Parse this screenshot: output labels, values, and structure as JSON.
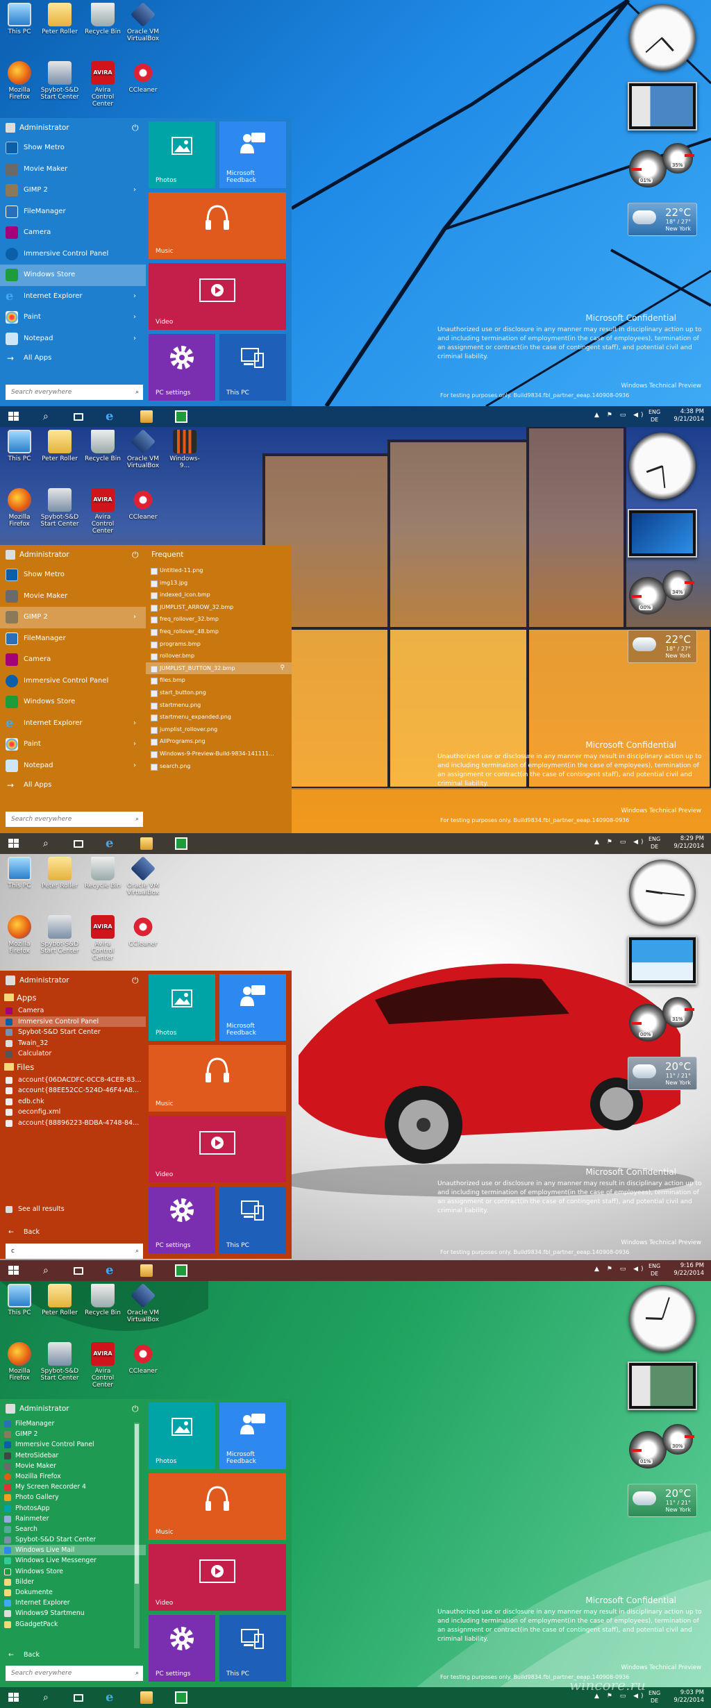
{
  "desktop_icons_row1": [
    "This PC",
    "Peter Roller",
    "Recycle Bin",
    "Oracle VM VirtualBox"
  ],
  "desktop_icons_row2": [
    "Mozilla Firefox",
    "Spybot-S&D Start Center",
    "Avira Control Center",
    "CCleaner"
  ],
  "extra_icon": "Windows-9...",
  "avira_text": "AVIRA",
  "user": "Administrator",
  "power_glyph": "⏻",
  "arrow_glyph": "›",
  "all_apps": "All Apps",
  "back": "Back",
  "search_placeholder": "Search everywhere",
  "search_query": "c",
  "frequent_title": "Frequent",
  "menu_items": [
    "Show Metro",
    "Movie Maker",
    "GIMP 2",
    "FileManager",
    "Camera",
    "Immersive Control Panel",
    "Windows Store",
    "Internet Explorer",
    "Paint",
    "Notepad"
  ],
  "frequent_items": [
    "Untitled-11.png",
    "img13.jpg",
    "indexed_icon.bmp",
    "JUMPLIST_ARROW_32.bmp",
    "freq_rollover_32.bmp",
    "freq_rollover_48.bmp",
    "programs.bmp",
    "rollover.bmp",
    "JUMPLIST_BUTTON_32.bmp",
    "files.bmp",
    "start_button.png",
    "startmenu.png",
    "startmenu_expanded.png",
    "jumplist_rollover.png",
    "AllPrograms.png",
    "Windows-9-Preview-Build-9834-141111...",
    "search.png"
  ],
  "search_results": {
    "apps_header": "Apps",
    "apps": [
      "Camera",
      "Immersive Control Panel",
      "Spybot-S&D Start Center",
      "Twain_32",
      "Calculator"
    ],
    "files_header": "Files",
    "files": [
      "account{06DACDFC-0CC8-4CEB-83...",
      "account{88EE52CC-524D-46F4-A8...",
      "edb.chk",
      "oeconfig.xml",
      "account{88896223-BDBA-4748-84..."
    ],
    "see_all": "See all results"
  },
  "all_apps_list": [
    "FileManager",
    "GIMP 2",
    "Immersive Control Panel",
    "MetroSidebar",
    "Movie Maker",
    "Mozilla Firefox",
    "My Screen Recorder 4",
    "Photo Gallery",
    "PhotosApp",
    "Rainmeter",
    "Search",
    "Spybot-S&D Start Center",
    "Windows Live Mail",
    "Windows Live Messenger",
    "Windows Store",
    "Bilder",
    "Dokumente",
    "Internet Explorer",
    "Windows9 Startmenu",
    "8GadgetPack"
  ],
  "tiles": {
    "photos": "Photos",
    "feedback": "Microsoft Feedback",
    "music": "Music",
    "video": "Video",
    "settings": "PC settings",
    "thispc": "This PC"
  },
  "watermark": {
    "title": "Microsoft Confidential",
    "body": "Unauthorized use or disclosure in any manner may result in disciplinary action up to and including termination of employment(in the case of employees), termination of an assignment or contract(in the case of contingent staff), and potential civil and criminal liability.",
    "preview": "Windows Technical Preview",
    "build": "For testing purposes only. Build9834.fbl_partner_eeap.140908-0936"
  },
  "taskbar": {
    "lang1": "ENG",
    "lang2": "DE",
    "tray": "▲ ⚑ ▭ ◀)"
  },
  "panels": [
    {
      "time": "4:38 PM",
      "date": "9/21/2014",
      "weather": {
        "temp": "22°C",
        "range": "18° / 27°",
        "city": "New York"
      },
      "cpu": "01%",
      "mem": "35%"
    },
    {
      "time": "8:29 PM",
      "date": "9/21/2014",
      "weather": {
        "temp": "22°C",
        "range": "18° / 27°",
        "city": "New York"
      },
      "cpu": "00%",
      "mem": "34%"
    },
    {
      "time": "9:16 PM",
      "date": "9/22/2014",
      "weather": {
        "temp": "20°C",
        "range": "11° / 21°",
        "city": "New York"
      },
      "cpu": "00%",
      "mem": "31%"
    },
    {
      "time": "9:03 PM",
      "date": "9/22/2014",
      "weather": {
        "temp": "20°C",
        "range": "11° / 21°",
        "city": "New York"
      },
      "cpu": "01%",
      "mem": "30%"
    }
  ],
  "site_mark": "wincore.ru",
  "colors": {
    "menu_blue": "#1d7fce",
    "menu_orange": "#c9780f",
    "menu_red": "#b9380c",
    "menu_green": "#1e9a52",
    "taskbar_blue": "#0e3a66",
    "taskbar_orange": "#3f3a32",
    "taskbar_red": "#5e2b2b",
    "taskbar_green": "#0f5a38",
    "tile_teal": "#00a3a6",
    "tile_blue": "#2d89ef",
    "tile_orange": "#e05a1e",
    "tile_crimson": "#c41f4a",
    "tile_purple": "#7a2fb0",
    "tile_navy": "#1e5fba"
  }
}
